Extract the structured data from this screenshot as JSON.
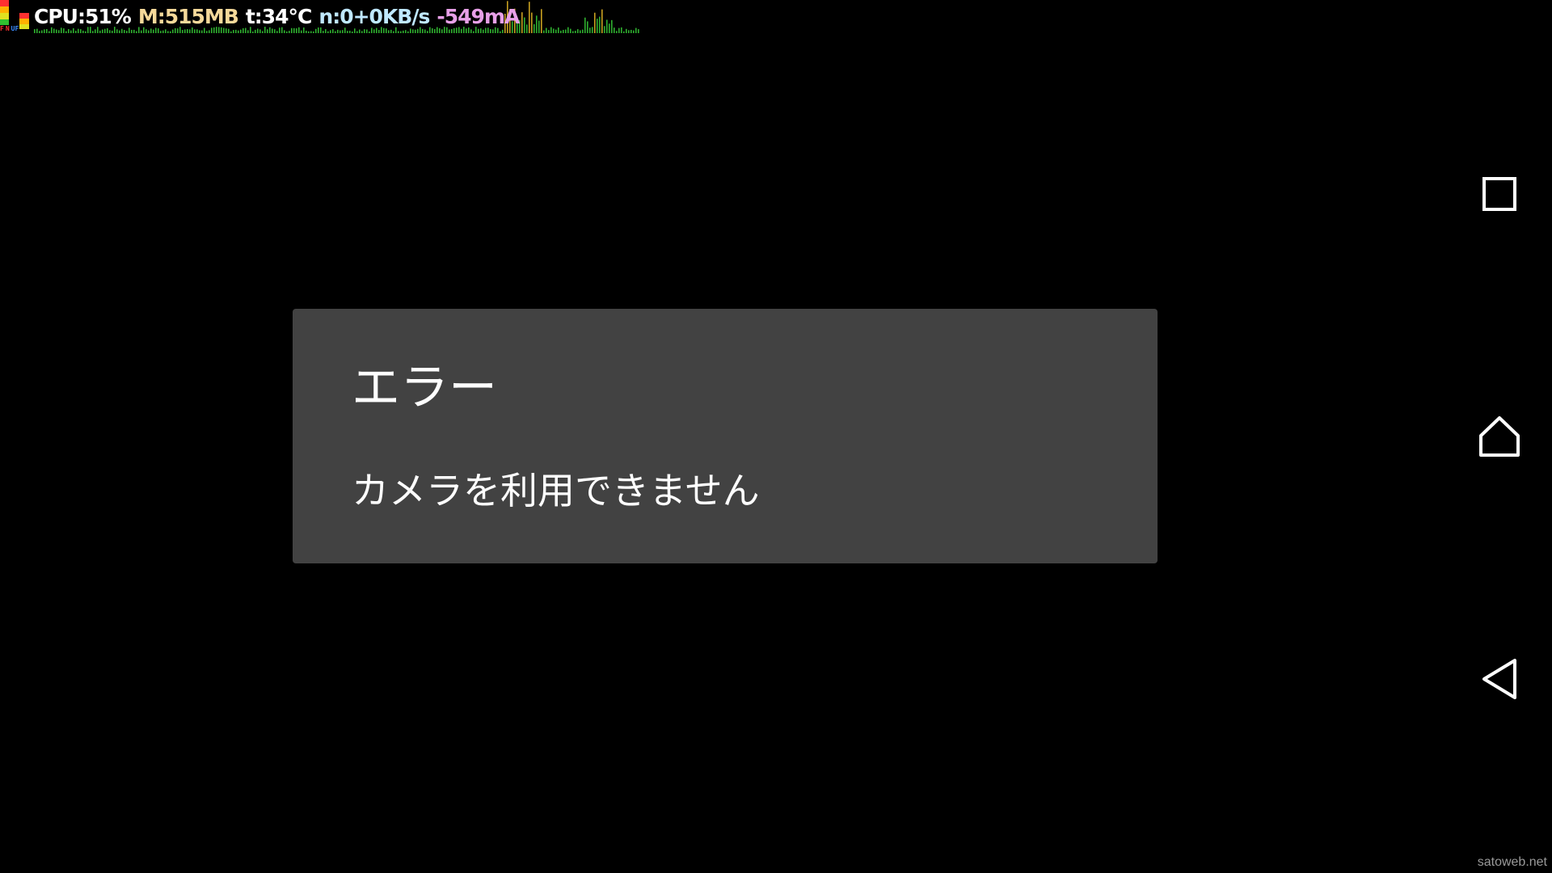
{
  "overlay": {
    "stats": [
      {
        "text": "CPU:51%",
        "color": "#ffffff"
      },
      {
        "text": "M:515MB",
        "color": "#f5d99a"
      },
      {
        "text": "t:34°C",
        "color": "#ffffff"
      },
      {
        "text": "n:0+0KB/s",
        "color": "#bfe8ff"
      },
      {
        "text": "-549mA",
        "color": "#e8a0e8"
      }
    ],
    "flags": [
      {
        "text": "F",
        "color": "#ff3030"
      },
      {
        "text": "N",
        "color": "#ff3030"
      },
      {
        "text": "UF",
        "color": "#3a8cff"
      }
    ]
  },
  "dialog": {
    "title": "エラー",
    "message": "カメラを利用できません"
  },
  "navbar": {
    "icons": [
      "recents-icon",
      "home-icon",
      "back-icon"
    ]
  },
  "watermark": "satoweb.net"
}
